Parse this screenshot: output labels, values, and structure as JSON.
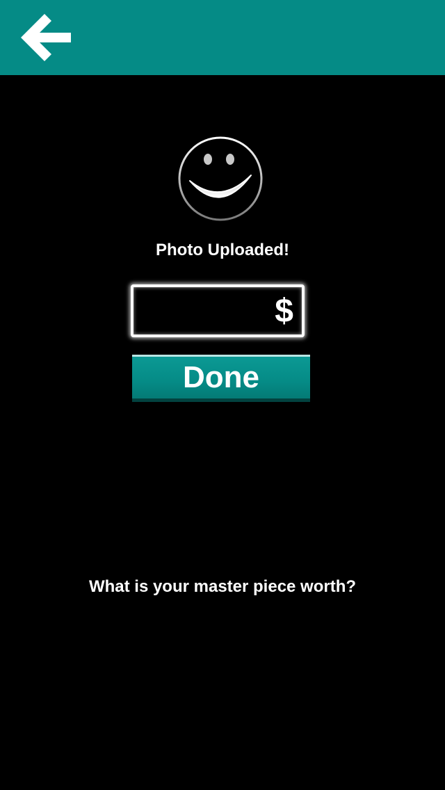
{
  "colors": {
    "accent": "#058b86",
    "background": "#000000",
    "text": "#ffffff"
  },
  "header": {
    "back_icon": "left-arrow-icon"
  },
  "upload": {
    "status_icon": "smiley-face-icon",
    "status_text": "Photo Uploaded!"
  },
  "price": {
    "value": "",
    "currency_symbol": "$"
  },
  "actions": {
    "done_label": "Done"
  },
  "prompt": {
    "text": "What is your master piece worth?"
  }
}
